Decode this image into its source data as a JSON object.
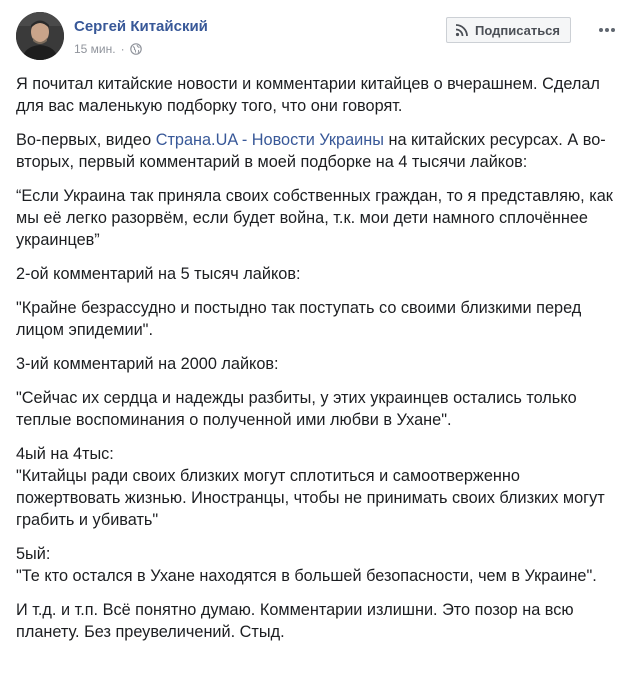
{
  "post": {
    "author": "Сергей Китайский",
    "time": "15 мин.",
    "dot": "·",
    "subscribe_label": "Подписаться",
    "icons": {
      "avatar": "avatar-photo",
      "audience": "globe-icon",
      "subscribe": "rss-icon",
      "more": "more-dots-icon"
    },
    "paragraphs": {
      "p1": "Я почитал китайские новости и комментарии китайцев о вчерашнем. Сделал для вас маленькую подборку того, что они говорят.",
      "p2_before": "Во-первых, видео ",
      "p2_link": "Страна.UA - Новости Украины",
      "p2_after": " на китайских ресурсах. А во-вторых, первый комментарий в моей подборке на 4 тысячи лайков:",
      "p3": "“Если Украина так приняла своих собственных граждан, то я представляю, как мы её легко разорвём, если будет война, т.к. мои дети намного сплочённее украинцев”",
      "p4": "2-ой комментарий на 5 тысяч лайков:",
      "p5": "\"Крайне безрассудно и постыдно так поступать со своими близкими перед лицом эпидемии\".",
      "p6": "3-ий комментарий на 2000 лайков:",
      "p7": "\"Сейчас их сердца и надежды разбиты, у этих украинцев остались только теплые воспоминания о полученной ими любви в Ухане\".",
      "p8_title": "4ый на 4тыс:",
      "p8_text": "\"Китайцы ради своих близких могут сплотиться и самоотверженно пожертвовать жизнью. Иностранцы, чтобы не принимать своих близких могут грабить и убивать\"",
      "p9_title": "5ый:",
      "p9_text": "\"Те кто остался в Ухане находятся в большей безопасности, чем в Украине\".",
      "p10": "И т.д. и т.п. Всё понятно думаю. Комментарии излишни. Это позор на всю планету. Без преувеличений. Стыд."
    }
  },
  "colors": {
    "link": "#385898",
    "text": "#1c1e21",
    "meta": "#90949c"
  }
}
